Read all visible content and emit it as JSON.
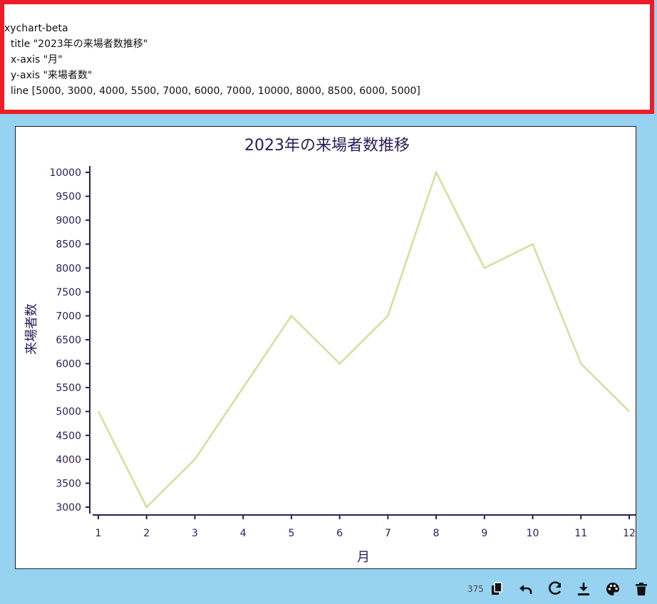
{
  "editor": {
    "lines": [
      "xychart-beta",
      "  title \"2023年の来場者数推移\"",
      "  x-axis \"月\"",
      "  y-axis \"来場者数\"",
      "  line [5000, 3000, 4000, 5500, 7000, 6000, 7000, 10000, 8000, 8500, 6000, 5000]"
    ]
  },
  "colors": {
    "editor_border": "#ec1f28",
    "page_background": "#97d3f0",
    "axis": "#2d1b5e",
    "line": "#cfe29c"
  },
  "chart_data": {
    "type": "line",
    "title": "2023年の来場者数推移",
    "xlabel": "月",
    "ylabel": "来場者数",
    "categories": [
      "1",
      "2",
      "3",
      "4",
      "5",
      "6",
      "7",
      "8",
      "9",
      "10",
      "11",
      "12"
    ],
    "values": [
      5000,
      3000,
      4000,
      5500,
      7000,
      6000,
      7000,
      10000,
      8000,
      8500,
      6000,
      5000
    ],
    "yticks": [
      3000,
      3500,
      4000,
      4500,
      5000,
      5500,
      6000,
      6500,
      7000,
      7500,
      8000,
      8500,
      9000,
      9500,
      10000
    ],
    "ylim": [
      3000,
      10000
    ],
    "grid": false
  },
  "toolbar": {
    "char_count": "375",
    "icons": [
      "copy-icon",
      "undo-icon",
      "redo-icon",
      "download-icon",
      "palette-icon",
      "trash-icon"
    ]
  }
}
